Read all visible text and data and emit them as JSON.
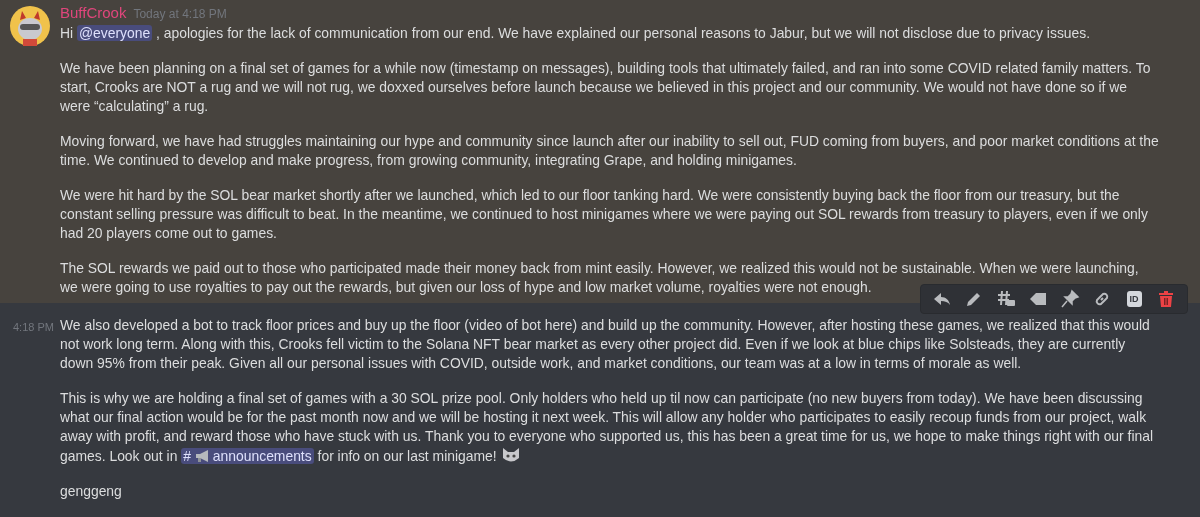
{
  "messages": [
    {
      "author": "BuffCrook",
      "timestamp": "Today at 4:18 PM",
      "highlighted": true,
      "paragraphs": [
        [
          {
            "kind": "text",
            "text": "Hi "
          },
          {
            "kind": "mention",
            "text": "@everyone"
          },
          {
            "kind": "text",
            "text": " , apologies for the lack of communication from our end. We have explained our personal reasons to Jabur, but we will not disclose due to privacy issues."
          }
        ],
        [
          {
            "kind": "text",
            "text": "We have been planning on a final set of games for a while now (timestamp on messages), building tools that ultimately failed, and ran into some COVID related family matters. To start, Crooks are NOT a rug and we will not rug, we doxxed ourselves before launch because we believed in this project and our community. We would not have done so if we were “calculating” a rug."
          }
        ],
        [
          {
            "kind": "text",
            "text": "Moving forward, we have had struggles maintaining our hype and community since launch after our inability to sell out, FUD coming from buyers, and poor market conditions at the time. We continued to develop and make progress, from growing community, integrating Grape, and holding minigames."
          }
        ],
        [
          {
            "kind": "text",
            "text": "We were hit hard by the SOL bear market shortly after we launched, which led to our floor tanking hard. We were consistently buying back the floor from our treasury, but the constant selling pressure was difficult to beat. In the meantime, we continued to host minigames where we were paying out SOL rewards from treasury to players, even if we only had 20 players come out to games."
          }
        ],
        [
          {
            "kind": "text",
            "text": "The SOL rewards we paid out to those who participated made their money back from mint easily. However, we realized this would not be sustainable. When we were launching, we were going to use royalties to pay out the rewards, but given our loss of hype and low market volume, royalties were not enough."
          }
        ]
      ],
      "actions": [
        {
          "kind": "reply"
        },
        {
          "kind": "edit"
        },
        {
          "kind": "thread"
        },
        {
          "kind": "tag"
        },
        {
          "kind": "pin"
        },
        {
          "kind": "link"
        },
        {
          "kind": "id",
          "label": "ID"
        },
        {
          "kind": "delete"
        }
      ]
    },
    {
      "timestamp": "4:18 PM",
      "highlighted": false,
      "paragraphs": [
        [
          {
            "kind": "text",
            "text": "We also developed a bot to track floor prices and buy up the floor (video of bot here) and build up the community. However, after hosting these games, we realized that this would not work long term. Along with this, Crooks fell victim to the Solana NFT bear market as every other project did. Even if we look at blue chips like Solsteads, they are currently down 95% from their peak. Given all our personal issues with COVID, outside work, and market conditions, our team was at a low in terms of morale as well."
          }
        ],
        [
          {
            "kind": "text",
            "text": "This is why we are holding a final set of games with a 30 SOL prize pool. Only holders who held up til now can participate (no new buyers from today). We have been discussing what our final action would be for the past month now and we will be hosting it next week. This will allow any holder who participates to easily recoup funds from our project, walk away with profit, and reward those who have stuck with us. Thank you to everyone who supported us, this has been a great time for us, we hope to make things right with our final games. Look out in "
          },
          {
            "kind": "channel",
            "prefix": "#",
            "text": "announcements"
          },
          {
            "kind": "text",
            "text": "  for info on our last minigame! "
          },
          {
            "kind": "emoji"
          }
        ],
        [
          {
            "kind": "text",
            "text": "genggeng"
          }
        ]
      ]
    }
  ]
}
